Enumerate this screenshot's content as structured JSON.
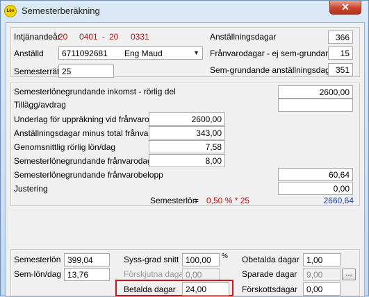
{
  "window": {
    "title": "Semesterberäkning",
    "icon_text": "Lön",
    "close_label": "✕"
  },
  "top": {
    "intjanandear_label": "Intjänandeår",
    "intjanandear_start_prefix": "20",
    "intjanandear_start_suffix": "0401",
    "intjanandear_sep": "-",
    "intjanandear_end_prefix": "20",
    "intjanandear_end_suffix": "0331",
    "anstalld_label": "Anställd",
    "anstalld_number": "6711092681",
    "anstalld_name": "Eng Maud",
    "semesterratt_label": "Semesterrätt",
    "semesterratt_value": "25",
    "anstallningsdagar_label": "Anställningsdagar",
    "anstallningsdagar_value": "366",
    "franvarodagar_label": "Frånvarodagar - ej sem-grundande",
    "franvarodagar_value": "15",
    "semgrundande_label": "Sem-grundande anställningsdagar",
    "semgrundande_value": "351"
  },
  "middle": {
    "inkomst_label": "Semesterlönegrundande inkomst - rörlig del",
    "inkomst_value": "2600,00",
    "tillagg_label": "Tillägg/avdrag",
    "tillagg_value": "",
    "underlag_label": "Underlag för uppräkning vid frånvaro",
    "underlag_value": "2600,00",
    "anstdagar_minus_label": "Anställningsdagar minus total frånvaro",
    "anstdagar_minus_value": "343,00",
    "genomsnitt_label": "Genomsnittlig rörlig lön/dag",
    "genomsnitt_value": "7,58",
    "franvarodagar_label": "Semesterlönegrundande frånvarodagar",
    "franvarodagar_value": "8,00",
    "franvarobelopp_label": "Semesterlönegrundande frånvarobelopp",
    "franvarobelopp_value": "60,64",
    "justering_label": "Justering",
    "justering_value": "0,00",
    "semesterlon_label": "Semesterlön",
    "semesterlon_eq": "=",
    "semesterlon_formula": "0,50 % * 25",
    "semesterlon_value": "2660,64"
  },
  "bottom": {
    "semesterlon_label": "Semesterlön",
    "semesterlon_value": "399,04",
    "semlondag_label": "Sem-lön/dag",
    "semlondag_value": "13,76",
    "syssgrad_label": "Syss-grad snitt",
    "syssgrad_value": "100,00",
    "syssgrad_unit": "%",
    "forskjutna_label": "Förskjutna dagar",
    "forskjutna_value": "0,00",
    "betalda_label": "Betalda dagar",
    "betalda_value": "24,00",
    "obetalda_label": "Obetalda dagar",
    "obetalda_value": "1,00",
    "sparade_label": "Sparade dagar",
    "sparade_value": "9,00",
    "sparade_button": "...",
    "forskott_label": "Förskottsdagar",
    "forskott_value": "0,00"
  },
  "colors": {
    "highlight": "#c41a1a",
    "total_blue": "#1d3fa0",
    "formula_red": "#b41414"
  }
}
